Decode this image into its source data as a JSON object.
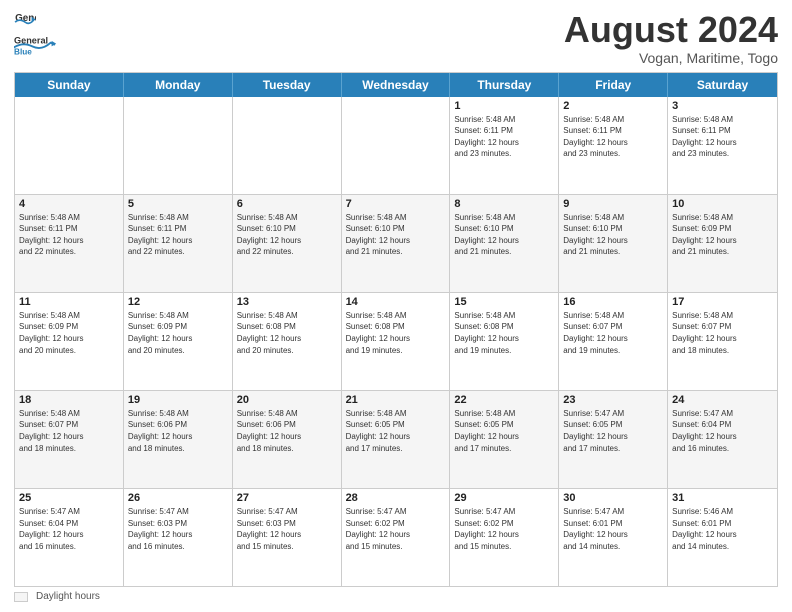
{
  "header": {
    "logo_text_general": "General",
    "logo_text_blue": "Blue",
    "month_title": "August 2024",
    "location": "Vogan, Maritime, Togo"
  },
  "days_of_week": [
    "Sunday",
    "Monday",
    "Tuesday",
    "Wednesday",
    "Thursday",
    "Friday",
    "Saturday"
  ],
  "footer": {
    "legend_label": "Daylight hours"
  },
  "weeks": [
    {
      "alt": false,
      "cells": [
        {
          "day": "",
          "info": ""
        },
        {
          "day": "",
          "info": ""
        },
        {
          "day": "",
          "info": ""
        },
        {
          "day": "",
          "info": ""
        },
        {
          "day": "1",
          "info": "Sunrise: 5:48 AM\nSunset: 6:11 PM\nDaylight: 12 hours\nand 23 minutes."
        },
        {
          "day": "2",
          "info": "Sunrise: 5:48 AM\nSunset: 6:11 PM\nDaylight: 12 hours\nand 23 minutes."
        },
        {
          "day": "3",
          "info": "Sunrise: 5:48 AM\nSunset: 6:11 PM\nDaylight: 12 hours\nand 23 minutes."
        }
      ]
    },
    {
      "alt": true,
      "cells": [
        {
          "day": "4",
          "info": "Sunrise: 5:48 AM\nSunset: 6:11 PM\nDaylight: 12 hours\nand 22 minutes."
        },
        {
          "day": "5",
          "info": "Sunrise: 5:48 AM\nSunset: 6:11 PM\nDaylight: 12 hours\nand 22 minutes."
        },
        {
          "day": "6",
          "info": "Sunrise: 5:48 AM\nSunset: 6:10 PM\nDaylight: 12 hours\nand 22 minutes."
        },
        {
          "day": "7",
          "info": "Sunrise: 5:48 AM\nSunset: 6:10 PM\nDaylight: 12 hours\nand 21 minutes."
        },
        {
          "day": "8",
          "info": "Sunrise: 5:48 AM\nSunset: 6:10 PM\nDaylight: 12 hours\nand 21 minutes."
        },
        {
          "day": "9",
          "info": "Sunrise: 5:48 AM\nSunset: 6:10 PM\nDaylight: 12 hours\nand 21 minutes."
        },
        {
          "day": "10",
          "info": "Sunrise: 5:48 AM\nSunset: 6:09 PM\nDaylight: 12 hours\nand 21 minutes."
        }
      ]
    },
    {
      "alt": false,
      "cells": [
        {
          "day": "11",
          "info": "Sunrise: 5:48 AM\nSunset: 6:09 PM\nDaylight: 12 hours\nand 20 minutes."
        },
        {
          "day": "12",
          "info": "Sunrise: 5:48 AM\nSunset: 6:09 PM\nDaylight: 12 hours\nand 20 minutes."
        },
        {
          "day": "13",
          "info": "Sunrise: 5:48 AM\nSunset: 6:08 PM\nDaylight: 12 hours\nand 20 minutes."
        },
        {
          "day": "14",
          "info": "Sunrise: 5:48 AM\nSunset: 6:08 PM\nDaylight: 12 hours\nand 19 minutes."
        },
        {
          "day": "15",
          "info": "Sunrise: 5:48 AM\nSunset: 6:08 PM\nDaylight: 12 hours\nand 19 minutes."
        },
        {
          "day": "16",
          "info": "Sunrise: 5:48 AM\nSunset: 6:07 PM\nDaylight: 12 hours\nand 19 minutes."
        },
        {
          "day": "17",
          "info": "Sunrise: 5:48 AM\nSunset: 6:07 PM\nDaylight: 12 hours\nand 18 minutes."
        }
      ]
    },
    {
      "alt": true,
      "cells": [
        {
          "day": "18",
          "info": "Sunrise: 5:48 AM\nSunset: 6:07 PM\nDaylight: 12 hours\nand 18 minutes."
        },
        {
          "day": "19",
          "info": "Sunrise: 5:48 AM\nSunset: 6:06 PM\nDaylight: 12 hours\nand 18 minutes."
        },
        {
          "day": "20",
          "info": "Sunrise: 5:48 AM\nSunset: 6:06 PM\nDaylight: 12 hours\nand 18 minutes."
        },
        {
          "day": "21",
          "info": "Sunrise: 5:48 AM\nSunset: 6:05 PM\nDaylight: 12 hours\nand 17 minutes."
        },
        {
          "day": "22",
          "info": "Sunrise: 5:48 AM\nSunset: 6:05 PM\nDaylight: 12 hours\nand 17 minutes."
        },
        {
          "day": "23",
          "info": "Sunrise: 5:47 AM\nSunset: 6:05 PM\nDaylight: 12 hours\nand 17 minutes."
        },
        {
          "day": "24",
          "info": "Sunrise: 5:47 AM\nSunset: 6:04 PM\nDaylight: 12 hours\nand 16 minutes."
        }
      ]
    },
    {
      "alt": false,
      "cells": [
        {
          "day": "25",
          "info": "Sunrise: 5:47 AM\nSunset: 6:04 PM\nDaylight: 12 hours\nand 16 minutes."
        },
        {
          "day": "26",
          "info": "Sunrise: 5:47 AM\nSunset: 6:03 PM\nDaylight: 12 hours\nand 16 minutes."
        },
        {
          "day": "27",
          "info": "Sunrise: 5:47 AM\nSunset: 6:03 PM\nDaylight: 12 hours\nand 15 minutes."
        },
        {
          "day": "28",
          "info": "Sunrise: 5:47 AM\nSunset: 6:02 PM\nDaylight: 12 hours\nand 15 minutes."
        },
        {
          "day": "29",
          "info": "Sunrise: 5:47 AM\nSunset: 6:02 PM\nDaylight: 12 hours\nand 15 minutes."
        },
        {
          "day": "30",
          "info": "Sunrise: 5:47 AM\nSunset: 6:01 PM\nDaylight: 12 hours\nand 14 minutes."
        },
        {
          "day": "31",
          "info": "Sunrise: 5:46 AM\nSunset: 6:01 PM\nDaylight: 12 hours\nand 14 minutes."
        }
      ]
    }
  ]
}
